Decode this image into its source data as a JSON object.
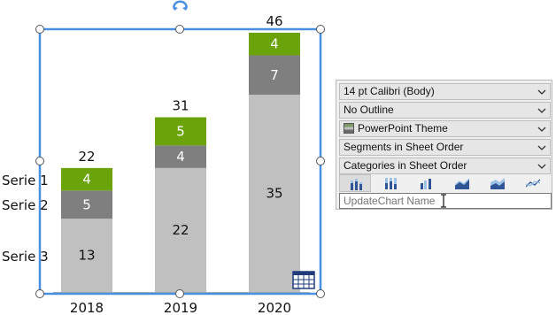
{
  "chart_data": {
    "type": "bar",
    "stacked": true,
    "categories": [
      "2018",
      "2019",
      "2020"
    ],
    "series": [
      {
        "name": "Serie 1",
        "values": [
          4,
          5,
          4
        ],
        "color": "#6aa30a"
      },
      {
        "name": "Serie 2",
        "values": [
          5,
          4,
          7
        ],
        "color": "#7f7f7f"
      },
      {
        "name": "Serie 3",
        "values": [
          13,
          22,
          35
        ],
        "color": "#c0c0c0"
      }
    ],
    "totals": [
      "22",
      "31",
      "46"
    ],
    "title": "",
    "xlabel": "",
    "ylabel": "",
    "ylim": [
      0,
      46
    ]
  },
  "panel": {
    "font": "14 pt Calibri (Body)",
    "outline": "No Outline",
    "theme": "PowerPoint Theme",
    "segments": "Segments in Sheet Order",
    "categories": "Categories in Sheet Order",
    "chart_type_icons": [
      "stacked-bar-icon",
      "stacked-100-bar-icon",
      "clustered-bar-icon",
      "area-icon",
      "stacked-area-icon",
      "line-icon"
    ],
    "name_placeholder": "UpdateChart Name"
  },
  "colors": {
    "selection": "#4a90e2",
    "accent_green": "#6aa30a"
  }
}
